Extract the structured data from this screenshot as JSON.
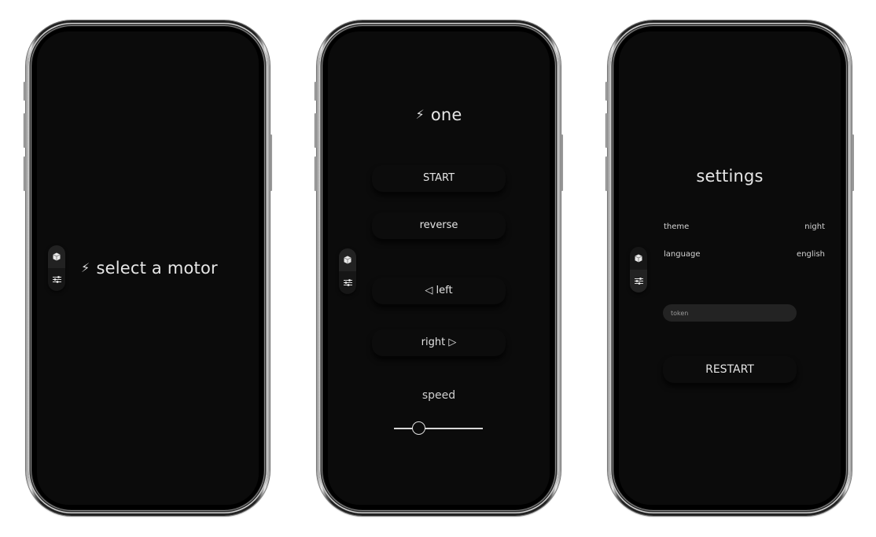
{
  "colors": {
    "screen_bg": "#0b0b0b",
    "text": "#e6e6e6",
    "tab_active": "#222222",
    "input_bg": "#232323"
  },
  "tabs": [
    {
      "icon": "cube-icon",
      "label": "motors"
    },
    {
      "icon": "sliders-icon",
      "label": "settings"
    }
  ],
  "screens": {
    "select": {
      "active_tab": "motors",
      "bolt_icon": "⚡",
      "title": "select a motor"
    },
    "motor": {
      "active_tab": "motors",
      "bolt_icon": "⚡",
      "title": "one",
      "buttons": {
        "start": "START",
        "reverse": "reverse",
        "left": "◁ left",
        "right": "right ▷"
      },
      "speed_label": "speed",
      "speed_value_fraction": 0.28
    },
    "settings": {
      "active_tab": "settings",
      "title": "settings",
      "rows": [
        {
          "label": "theme",
          "value": "night"
        },
        {
          "label": "language",
          "value": "english"
        }
      ],
      "token_placeholder": "token",
      "token_value": "",
      "restart_label": "RESTART"
    }
  }
}
